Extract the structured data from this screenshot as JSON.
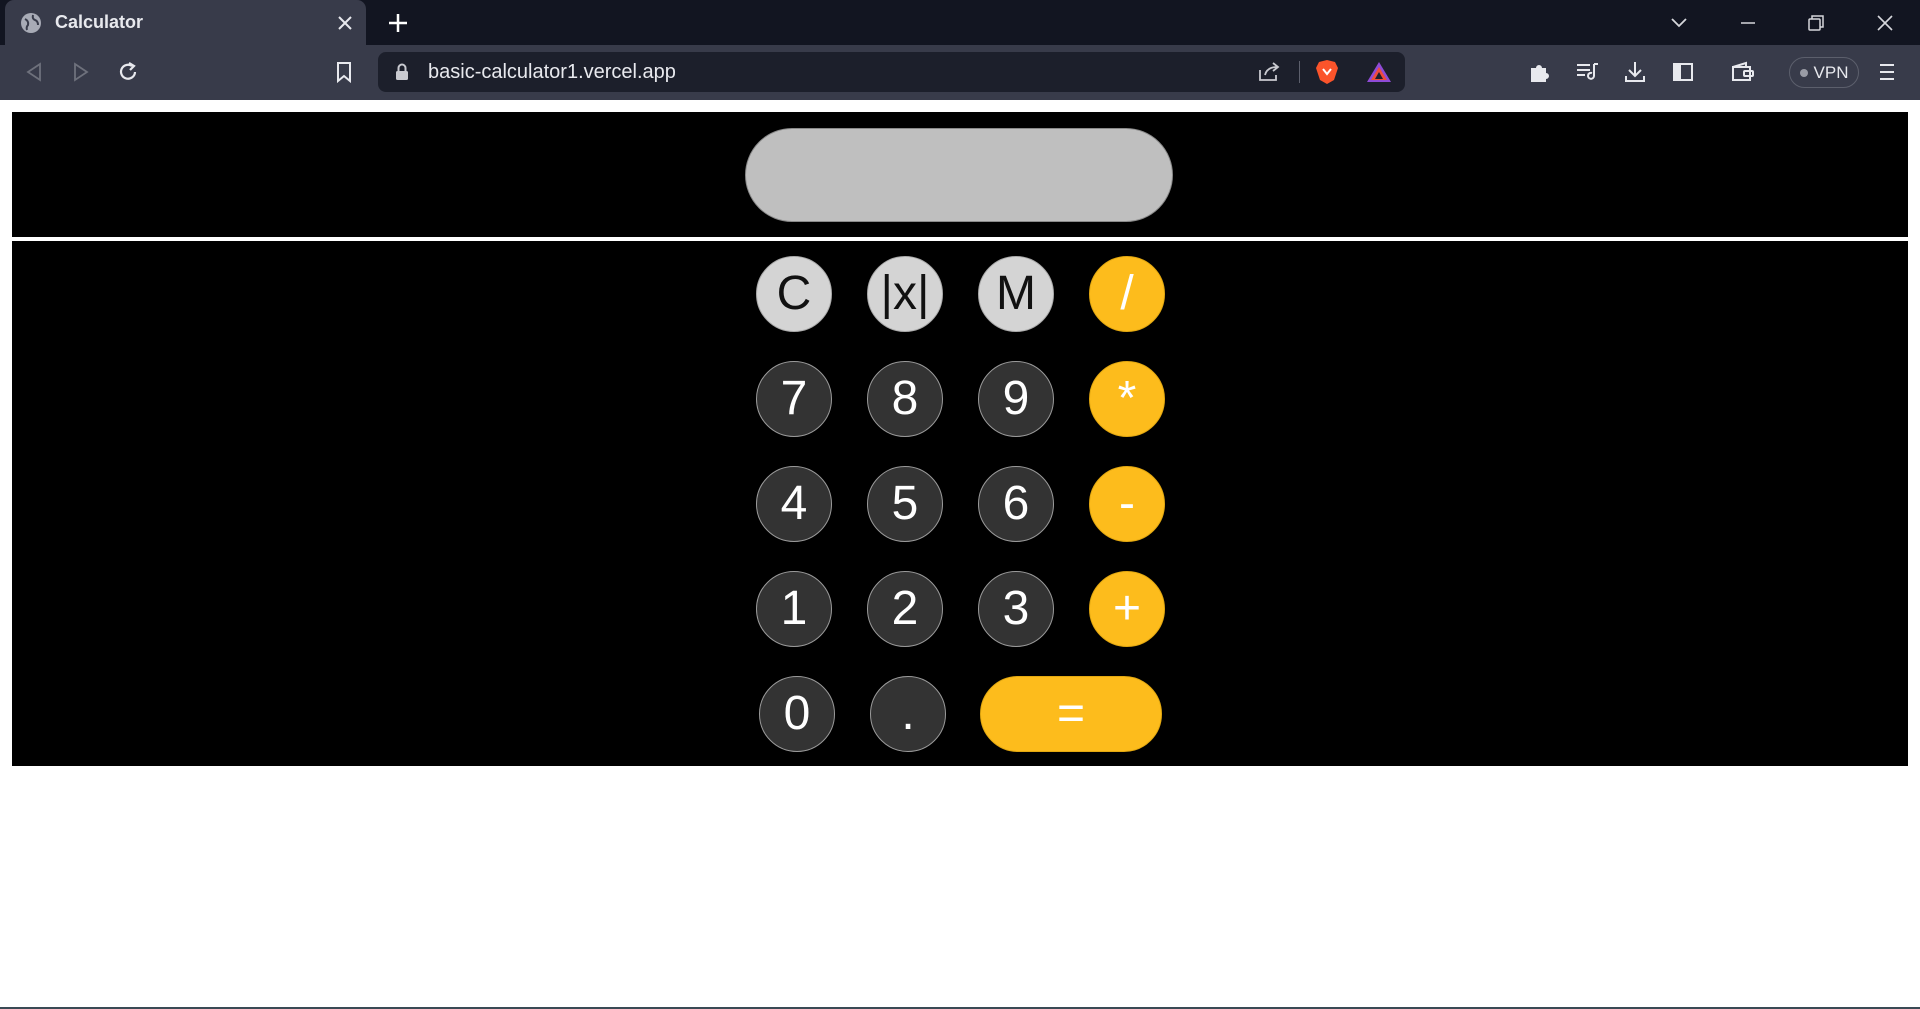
{
  "browser": {
    "tab": {
      "title": "Calculator",
      "favicon": "globe-icon"
    },
    "address_bar": {
      "url": "basic-calculator1.vercel.app"
    },
    "vpn_label": "VPN",
    "accent_brave": "#fb542b"
  },
  "calculator": {
    "display_value": "",
    "keys": {
      "clear": "C",
      "abs": "|x|",
      "memory": "M",
      "divide": "/",
      "seven": "7",
      "eight": "8",
      "nine": "9",
      "multiply": "*",
      "four": "4",
      "five": "5",
      "six": "6",
      "subtract": "-",
      "one": "1",
      "two": "2",
      "three": "3",
      "add": "+",
      "zero": "0",
      "decimal": ".",
      "equals": "="
    },
    "colors": {
      "digit_key": "#333333",
      "function_key": "#d4d4d4",
      "operator_key": "#fdbc1c",
      "display": "#bfbfbf",
      "panel": "#000000"
    }
  }
}
